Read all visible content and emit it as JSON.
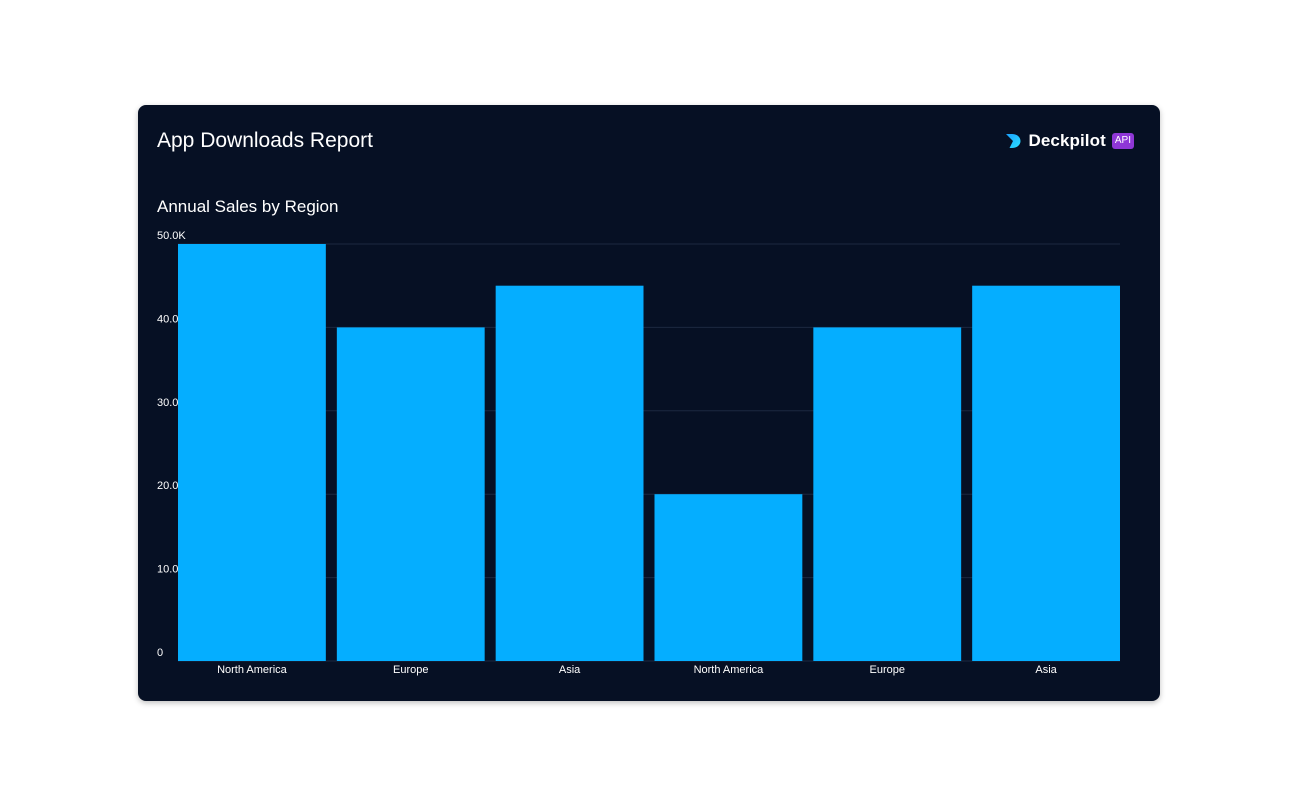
{
  "report": {
    "title": "App Downloads Report"
  },
  "brand": {
    "name": "Deckpilot",
    "badge": "API",
    "logo_icon": "deckpilot-logo-icon",
    "badge_color": "#8f37d6",
    "logo_gradient": [
      "#1aa0ff",
      "#2be0ff"
    ]
  },
  "colors": {
    "card_background": "#061024",
    "bar": "#05aeff",
    "gridline": "#1c2840",
    "text": "#ffffff"
  },
  "chart_data": {
    "type": "bar",
    "title": "Annual Sales by Region",
    "xlabel": "",
    "ylabel": "",
    "categories": [
      "North America",
      "Europe",
      "Asia",
      "North America",
      "Europe",
      "Asia"
    ],
    "values": [
      50000,
      40000,
      45000,
      20000,
      40000,
      45000
    ],
    "ylim": [
      0,
      50000
    ],
    "y_ticks": [
      0,
      10000,
      20000,
      30000,
      40000,
      50000
    ],
    "y_tick_labels": [
      "0",
      "10.0",
      "20.0",
      "30.0",
      "40.0",
      "50.0K"
    ],
    "grid": true,
    "legend": "none"
  }
}
